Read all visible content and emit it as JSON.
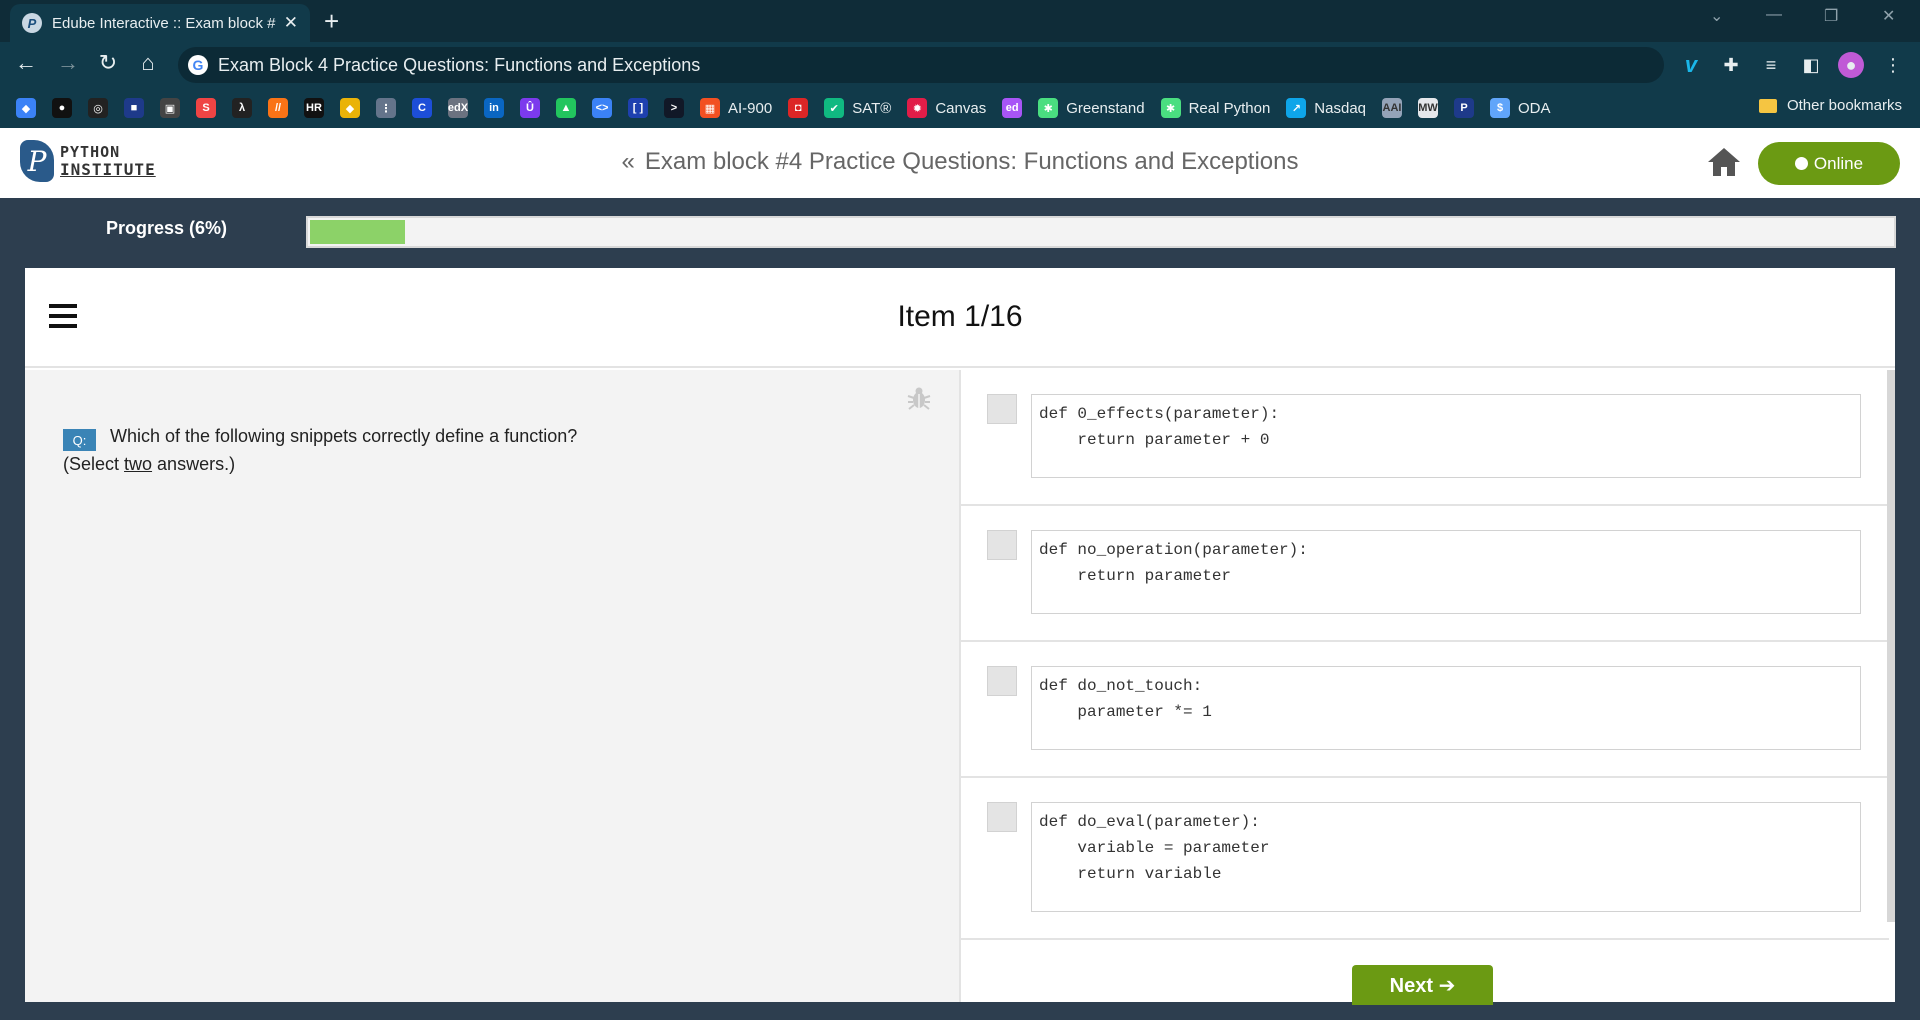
{
  "browser": {
    "tab_title": "Edube Interactive :: Exam block #",
    "omnibox_text": "Exam Block 4 Practice Questions: Functions and Exceptions",
    "bookmarks": [
      {
        "icon": "layers",
        "label": "",
        "color": "#3b82f6"
      },
      {
        "icon": "github",
        "label": "",
        "color": "#111111"
      },
      {
        "icon": "target",
        "label": "",
        "color": "#222222"
      },
      {
        "icon": "square",
        "label": "",
        "color": "#1e3a8a"
      },
      {
        "icon": "printer",
        "label": "",
        "color": "#444444"
      },
      {
        "icon": "swirl",
        "label": "",
        "color": "#ef4444"
      },
      {
        "icon": "lambda",
        "label": "",
        "color": "#222222"
      },
      {
        "icon": "slashes",
        "label": "",
        "color": "#f97316"
      },
      {
        "icon": "hr",
        "label": "",
        "color": "#111111"
      },
      {
        "icon": "leaf",
        "label": "",
        "color": "#eab308"
      },
      {
        "icon": "tree",
        "label": "",
        "color": "#64748b"
      },
      {
        "icon": "c",
        "label": "",
        "color": "#1d4ed8"
      },
      {
        "icon": "edx",
        "label": "",
        "color": "#6b7280"
      },
      {
        "icon": "linkedin",
        "label": "",
        "color": "#0a66c2"
      },
      {
        "icon": "udemy",
        "label": "",
        "color": "#7c3aed"
      },
      {
        "icon": "android",
        "label": "",
        "color": "#22c55e"
      },
      {
        "icon": "code",
        "label": "",
        "color": "#3b82f6"
      },
      {
        "icon": "brackets",
        "label": "",
        "color": "#1e40af"
      },
      {
        "icon": "terminal",
        "label": "",
        "color": "#111827"
      },
      {
        "icon": "microsoft",
        "label": "AI-900",
        "color": "#f25022"
      },
      {
        "icon": "shield",
        "label": "",
        "color": "#dc2626"
      },
      {
        "icon": "check-leaf",
        "label": "SAT®",
        "color": "#10b981"
      },
      {
        "icon": "canvas",
        "label": "Canvas",
        "color": "#e11d48"
      },
      {
        "icon": "ed",
        "label": "",
        "color": "#a855f7"
      },
      {
        "icon": "slack",
        "label": "Greenstand",
        "color": "#4ade80"
      },
      {
        "icon": "slack",
        "label": "Real Python",
        "color": "#4ade80"
      },
      {
        "icon": "chart",
        "label": "Nasdaq",
        "color": "#0ea5e9"
      },
      {
        "icon": "aai",
        "label": "",
        "color": "#94a3b8"
      },
      {
        "icon": "mw",
        "label": "",
        "color": "#e5e7eb"
      },
      {
        "icon": "python-institute",
        "label": "",
        "color": "#1e3a8a"
      },
      {
        "icon": "oda",
        "label": "ODA",
        "color": "#60a5fa"
      }
    ],
    "other_bookmarks": "Other bookmarks"
  },
  "header": {
    "logo_line1": "PYTHON",
    "logo_line2": "INSTITUTE",
    "exam_title": "Exam block #4 Practice Questions: Functions and Exceptions",
    "online_label": "Online"
  },
  "progress": {
    "label": "Progress (6%)",
    "percent": 6
  },
  "item": {
    "counter": "Item 1/16",
    "question_badge": "Q:",
    "question": "Which of the following snippets correctly define a function?",
    "hint_before": "(Select ",
    "hint_emph": "two",
    "hint_after": " answers.)"
  },
  "answers": [
    {
      "code": "def 0_effects(parameter):\n    return parameter + 0"
    },
    {
      "code": "def no_operation(parameter):\n    return parameter"
    },
    {
      "code": "def do_not_touch:\n    parameter *= 1"
    },
    {
      "code": "def do_eval(parameter):\n    variable = parameter\n    return variable"
    }
  ],
  "next_label": "Next ➔"
}
